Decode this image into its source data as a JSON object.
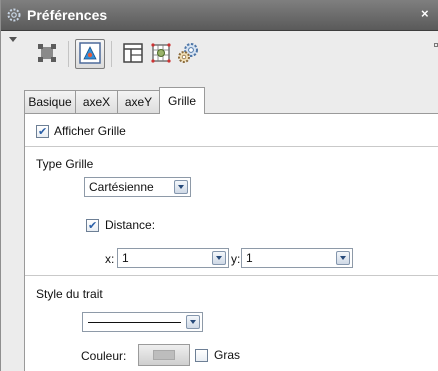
{
  "window": {
    "title": "Préférences",
    "close_glyph": "×"
  },
  "toolbar": {
    "buttons": [
      {
        "icon": "graphics-style-icon"
      },
      {
        "icon": "graphics-view-icon",
        "selected": true
      },
      {
        "icon": "layout-icon"
      },
      {
        "icon": "grid-settings-icon"
      },
      {
        "icon": "gear-settings-icon"
      }
    ]
  },
  "tabs": [
    {
      "label": "Basique"
    },
    {
      "label": "axeX"
    },
    {
      "label": "axeY"
    },
    {
      "label": "Grille",
      "active": true
    }
  ],
  "grille": {
    "show_grid_label": "Afficher Grille",
    "show_grid_checked": true,
    "grid_type_label": "Type Grille",
    "grid_type_value": "Cartésienne",
    "distance_label": "Distance:",
    "distance_checked": true,
    "x_label": "x:",
    "x_value": "1",
    "y_label": "y:",
    "y_value": "1",
    "line_style_label": "Style du trait",
    "color_label": "Couleur:",
    "bold_label": "Gras",
    "bold_checked": false
  },
  "colors": {
    "titlebar": "#6e6e6e",
    "accent": "#2a5fa8"
  }
}
